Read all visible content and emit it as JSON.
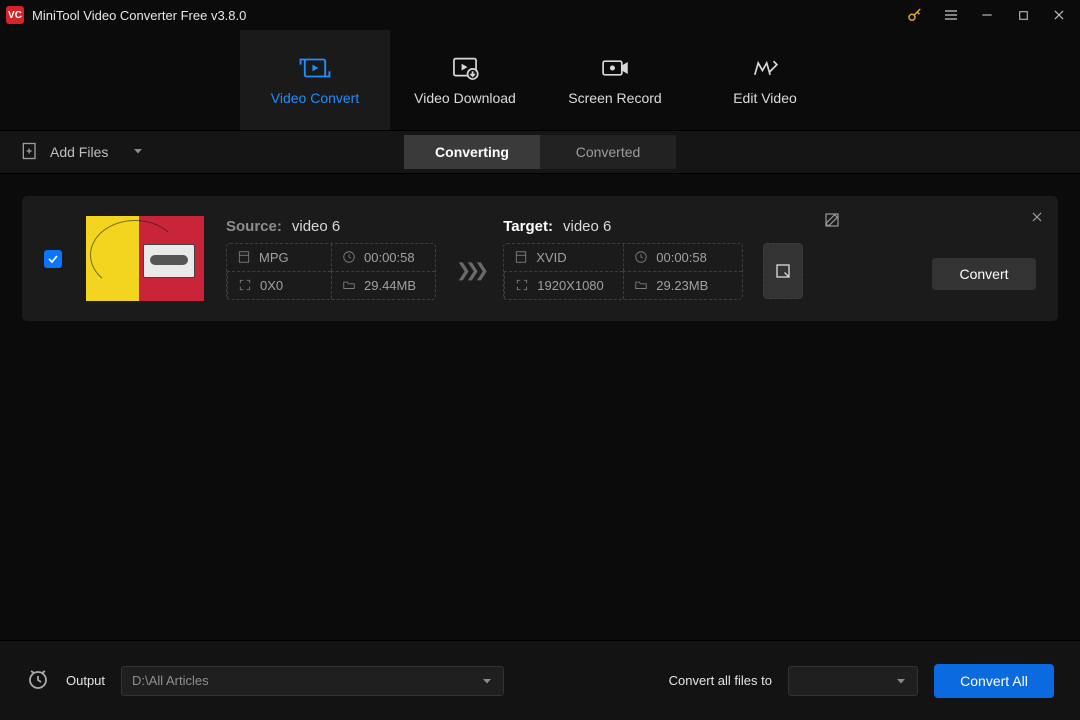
{
  "titlebar": {
    "app_title": "MiniTool Video Converter Free v3.8.0"
  },
  "topTabs": [
    {
      "label": "Video Convert"
    },
    {
      "label": "Video Download"
    },
    {
      "label": "Screen Record"
    },
    {
      "label": "Edit Video"
    }
  ],
  "toolbar": {
    "add_files": "Add Files"
  },
  "statusTabs": {
    "converting": "Converting",
    "converted": "Converted"
  },
  "file": {
    "source_label": "Source:",
    "source_name": "video 6",
    "source": {
      "format": "MPG",
      "duration": "00:00:58",
      "resolution": "0X0",
      "size": "29.44MB"
    },
    "target_label": "Target:",
    "target_name": "video 6",
    "target": {
      "format": "XVID",
      "duration": "00:00:58",
      "resolution": "1920X1080",
      "size": "29.23MB"
    },
    "convert_btn": "Convert"
  },
  "footer": {
    "output_label": "Output",
    "output_path": "D:\\All Articles",
    "convert_all_label": "Convert all files to",
    "convert_all_btn": "Convert All"
  }
}
